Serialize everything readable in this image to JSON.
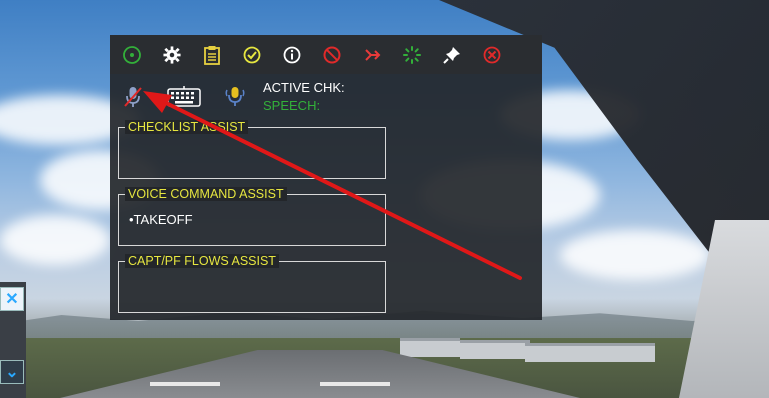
{
  "toolbar": {
    "icons": [
      "power-icon",
      "gear-icon",
      "clipboard-icon",
      "check-circle-icon",
      "info-icon",
      "no-entry-icon",
      "fast-forward-icon",
      "spinner-icon",
      "pin-icon",
      "close-circle-icon"
    ]
  },
  "status": {
    "active_chk_label": "ACTIVE CHK:",
    "speech_label": "SPEECH:"
  },
  "sections": [
    {
      "title": "CHECKLIST ASSIST",
      "items": []
    },
    {
      "title": "VOICE COMMAND ASSIST",
      "items": [
        "•TAKEOFF"
      ]
    },
    {
      "title": "CAPT/PF FLOWS ASSIST",
      "items": []
    }
  ],
  "side_panel": {
    "close_glyph": "✕",
    "chevron_glyph": "⌄"
  },
  "colors": {
    "green": "#33b03a",
    "yellow": "#e6e640",
    "red": "#e02a2a",
    "annotation_arrow": "#e01818"
  }
}
